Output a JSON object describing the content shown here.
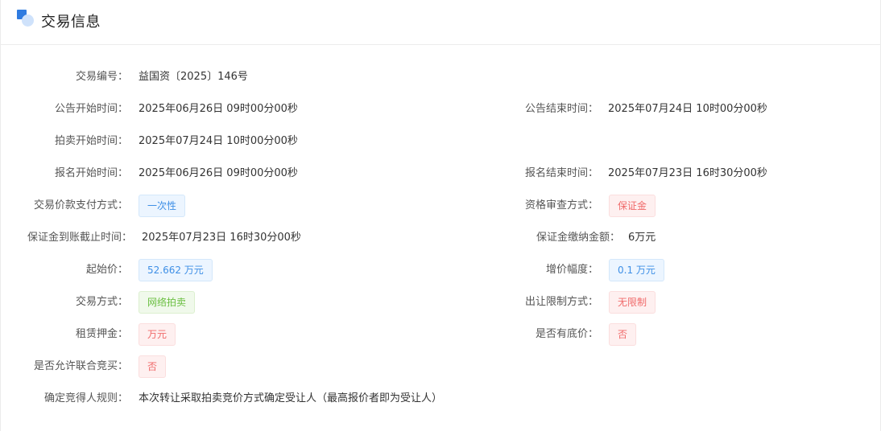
{
  "section": {
    "title": "交易信息"
  },
  "fields": {
    "trade_no": {
      "label": "交易编号：",
      "value": "益国资〔2025〕146号"
    },
    "notice_start": {
      "label": "公告开始时间：",
      "value": "2025年06月26日 09时00分00秒"
    },
    "notice_end": {
      "label": "公告结束时间：",
      "value": "2025年07月24日 10时00分00秒"
    },
    "auction_start": {
      "label": "拍卖开始时间：",
      "value": "2025年07月24日 10时00分00秒"
    },
    "signup_start": {
      "label": "报名开始时间：",
      "value": "2025年06月26日 09时00分00秒"
    },
    "signup_end": {
      "label": "报名结束时间：",
      "value": "2025年07月23日 16时30分00秒"
    },
    "payment_method": {
      "label": "交易价款支付方式：",
      "value": "一次性"
    },
    "qualification_method": {
      "label": "资格审查方式：",
      "value": "保证金"
    },
    "deposit_deadline": {
      "label": "保证金到账截止时间：",
      "value": "2025年07月23日 16时30分00秒"
    },
    "deposit_amount": {
      "label": "保证金缴纳金额：",
      "value": "6万元"
    },
    "starting_price": {
      "label": "起始价：",
      "value": "52.662 万元"
    },
    "increment": {
      "label": "增价幅度：",
      "value": "0.1 万元"
    },
    "trade_method": {
      "label": "交易方式：",
      "value": "网络拍卖"
    },
    "transfer_restriction": {
      "label": "出让限制方式：",
      "value": "无限制"
    },
    "lease_deposit": {
      "label": "租赁押金：",
      "value": "万元"
    },
    "reserve_price": {
      "label": "是否有底价：",
      "value": "否"
    },
    "joint_bid": {
      "label": "是否允许联合竞买：",
      "value": "否"
    },
    "winner_rule": {
      "label": "确定竞得人规则：",
      "value": "本次转让采取拍卖竞价方式确定受让人（最高报价者即为受让人）"
    }
  },
  "colors": {
    "accent": "#2f7be0",
    "tag_blue": "#3e8fe6",
    "tag_red": "#f06a6a",
    "tag_green": "#6bbf42"
  }
}
